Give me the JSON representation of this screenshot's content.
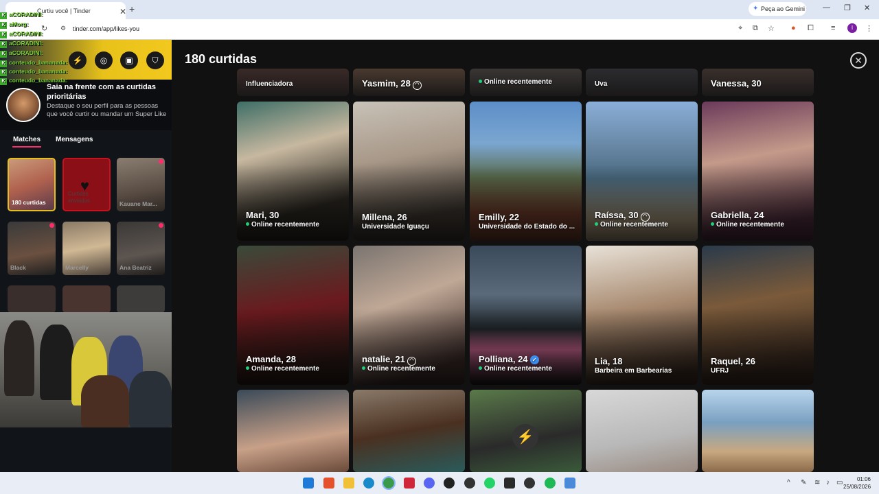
{
  "browser": {
    "tab_title": "Curtiu você | Tinder",
    "url": "tinder.com/app/likes-you",
    "gemini_label": "Peça ao Gemini",
    "profile_initial": "I"
  },
  "sidebar": {
    "promo_title": "Saia na frente com as curtidas prioritárias",
    "promo_desc": "Destaque o seu perfil para as pessoas que você curtir ou mandar um Super Like",
    "tabs": [
      "Matches",
      "Mensagens"
    ],
    "matches": [
      {
        "label": "180 curtidas"
      },
      {
        "label": ""
      },
      {
        "label": "Kauane Mar..."
      },
      {
        "label": "Black"
      },
      {
        "label": "Marcelly"
      },
      {
        "label": "Ana Beatriz"
      }
    ]
  },
  "chat": [
    "aCORADINI:",
    "aMorg:",
    "aCORADINI:",
    "aCORADINI:",
    "aCORADINI:",
    "conteudo_bananada:",
    "conteudo_bananada:",
    "conteudo_bananada:"
  ],
  "main": {
    "title": "180 curtidas",
    "top_row": [
      {
        "sub": "Influenciadora"
      },
      {
        "name": "Yasmim, 28"
      },
      {
        "sub": "Online recentemente"
      },
      {
        "sub": "Uva"
      },
      {
        "name": "Vanessa, 30"
      }
    ],
    "cards": [
      {
        "name": "Mari, 30",
        "sub": "Online recentemente",
        "online": true
      },
      {
        "name": "Millena, 26",
        "sub": "Universidade Iguaçu",
        "online": false
      },
      {
        "name": "Emilly, 22",
        "sub": "Universidade do Estado do ...",
        "online": false
      },
      {
        "name": "Raíssa, 30",
        "sub": "Online recentemente",
        "online": true
      },
      {
        "name": "Gabriella, 24",
        "sub": "Online recentemente",
        "online": true
      },
      {
        "name": "Amanda, 28",
        "sub": "Online recentemente",
        "online": true
      },
      {
        "name": "natalie, 21",
        "sub": "Online recentemente",
        "online": true
      },
      {
        "name": "Polliana, 24",
        "sub": "Online recentemente",
        "online": true
      },
      {
        "name": "Lia, 18",
        "sub": "Barbeira em Barbearias",
        "online": false
      },
      {
        "name": "Raquel, 26",
        "sub": "UFRJ",
        "online": false
      }
    ]
  },
  "taskbar": {
    "time": "01:06",
    "date": "25/08/2026"
  },
  "colors": {
    "accent": "#fd2d6b",
    "online": "#21d07a",
    "verified": "#3b8ff0"
  }
}
